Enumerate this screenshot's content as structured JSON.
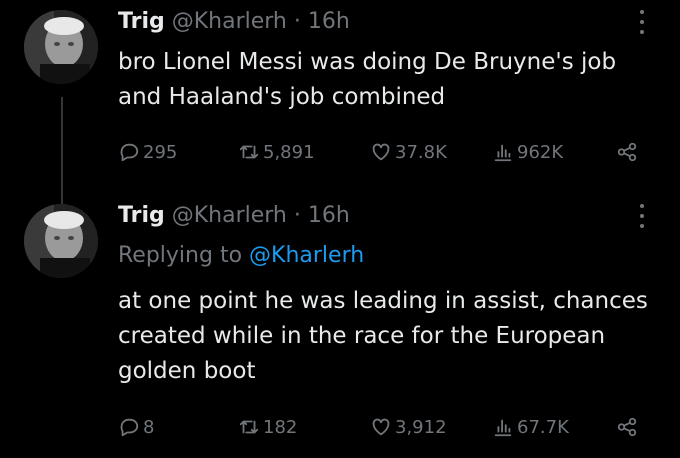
{
  "tweets": [
    {
      "name": "Trig",
      "handle": "@Kharlerh",
      "time": "· 16h",
      "text": "bro Lionel Messi was doing De Bruyne's job and Haaland's job combined",
      "replies": "295",
      "retweets": "5,891",
      "likes": "37.8K",
      "views": "962K"
    },
    {
      "name": "Trig",
      "handle": "@Kharlerh",
      "time": "· 16h",
      "replying_prefix": "Replying to",
      "replying_mention": "@Kharlerh",
      "text": "at one point he was leading in assist, chances created while in the race for the European golden boot",
      "replies": "8",
      "retweets": "182",
      "likes": "3,912",
      "views": "67.7K"
    }
  ],
  "icons": [
    "reply-icon",
    "retweet-icon",
    "like-icon",
    "views-icon",
    "share-icon",
    "more-icon"
  ],
  "colors": {
    "background": "#000000",
    "text": "#e7e9ea",
    "secondary": "#71767b",
    "link": "#1d9bf0"
  }
}
